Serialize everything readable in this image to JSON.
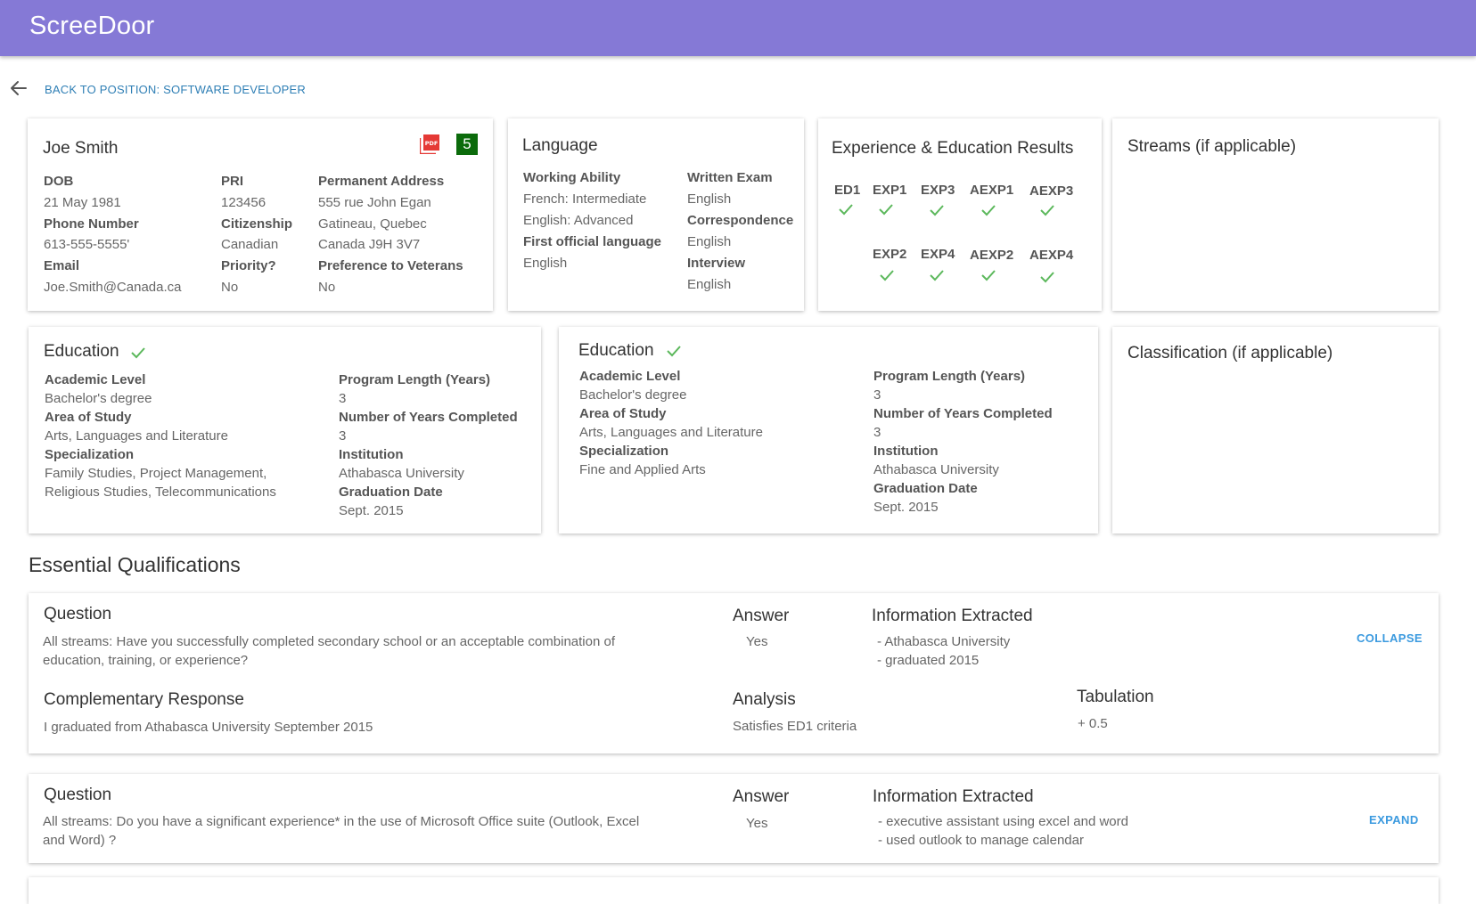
{
  "app": {
    "logo": "ScreeDoor"
  },
  "nav": {
    "back_label": "BACK TO POSITION: SOFTWARE DEVELOPER"
  },
  "applicant": {
    "name": "Joe Smith",
    "score_badge": "5",
    "dob_label": "DOB",
    "dob": "21 May 1981",
    "phone_label": "Phone Number",
    "phone": "613-555-5555'",
    "email_label": "Email",
    "email": "Joe.Smith@Canada.ca",
    "pri_label": "PRI",
    "pri": "123456",
    "citizenship_label": "Citizenship",
    "citizenship": "Canadian",
    "priority_label": "Priority?",
    "priority": "No",
    "address_label": "Permanent Address",
    "address_line1": "555 rue John Egan",
    "address_line2": "Gatineau, Quebec",
    "address_line3": "Canada J9H 3V7",
    "veterans_label": "Preference to Veterans",
    "veterans": "No"
  },
  "language": {
    "title": "Language",
    "working_ability_label": "Working Ability",
    "french": "French: Intermediate",
    "english": "English: Advanced",
    "first_official_label": "First official language",
    "first_official": "English",
    "written_exam_label": "Written Exam",
    "written_exam": "English",
    "correspondence_label": "Correspondence",
    "correspondence": "English",
    "interview_label": "Interview",
    "interview": "English"
  },
  "results": {
    "title": "Experience & Education Results",
    "row1": [
      "ED1",
      "EXP1",
      "EXP3",
      "AEXP1",
      "AEXP3"
    ],
    "row2": [
      "EXP2",
      "EXP4",
      "AEXP2",
      "AEXP4"
    ]
  },
  "streams": {
    "title": "Streams (if applicable)"
  },
  "classification": {
    "title": "Classification (if applicable)"
  },
  "education1": {
    "title": "Education",
    "academic_level_label": "Academic Level",
    "academic_level": "Bachelor's degree",
    "area_label": "Area of Study",
    "area": "Arts, Languages and Literature",
    "specialization_label": "Specialization",
    "specialization_line1": "Family Studies, Project Management,",
    "specialization_line2": "Religious Studies, Telecommunications",
    "program_length_label": "Program Length (Years)",
    "program_length": "3",
    "years_completed_label": "Number of Years Completed",
    "years_completed": "3",
    "institution_label": "Institution",
    "institution": "Athabasca University",
    "graduation_label": "Graduation Date",
    "graduation": "Sept. 2015"
  },
  "education2": {
    "title": "Education",
    "academic_level_label": "Academic Level",
    "academic_level": "Bachelor's degree",
    "area_label": "Area of Study",
    "area": "Arts, Languages and Literature",
    "specialization_label": "Specialization",
    "specialization": "Fine and Applied Arts",
    "program_length_label": "Program Length (Years)",
    "program_length": "3",
    "years_completed_label": "Number of Years Completed",
    "years_completed": "3",
    "institution_label": "Institution",
    "institution": "Athabasca University",
    "graduation_label": "Graduation Date",
    "graduation": "Sept. 2015"
  },
  "essential": {
    "title": "Essential Qualifications",
    "q1": {
      "question_label": "Question",
      "question_line1": "All streams: Have you successfully completed secondary school or an acceptable combination of",
      "question_line2": "education, training, or experience?",
      "answer_label": "Answer",
      "answer": "Yes",
      "info_label": "Information Extracted",
      "info_line1": "- Athabasca University",
      "info_line2": "- graduated 2015",
      "toggle": "COLLAPSE",
      "complementary_label": "Complementary Response",
      "complementary": "I graduated from Athabasca University September 2015",
      "analysis_label": "Analysis",
      "analysis": "Satisfies ED1 criteria",
      "tabulation_label": "Tabulation",
      "tabulation": "+ 0.5"
    },
    "q2": {
      "question_label": "Question",
      "question_line1": "All streams: Do you have a significant experience* in the use of Microsoft Office suite (Outlook, Excel",
      "question_line2": "and Word) ?",
      "answer_label": "Answer",
      "answer": "Yes",
      "info_label": "Information Extracted",
      "info_line1": "- executive assistant using excel and word",
      "info_line2": "- used outlook to manage calendar",
      "toggle": "EXPAND"
    }
  },
  "colors": {
    "header": "#8579d6",
    "link": "#2f7fb5",
    "check": "#5cb85c",
    "badge": "#0b6b0b",
    "pdf": "#e53935"
  }
}
